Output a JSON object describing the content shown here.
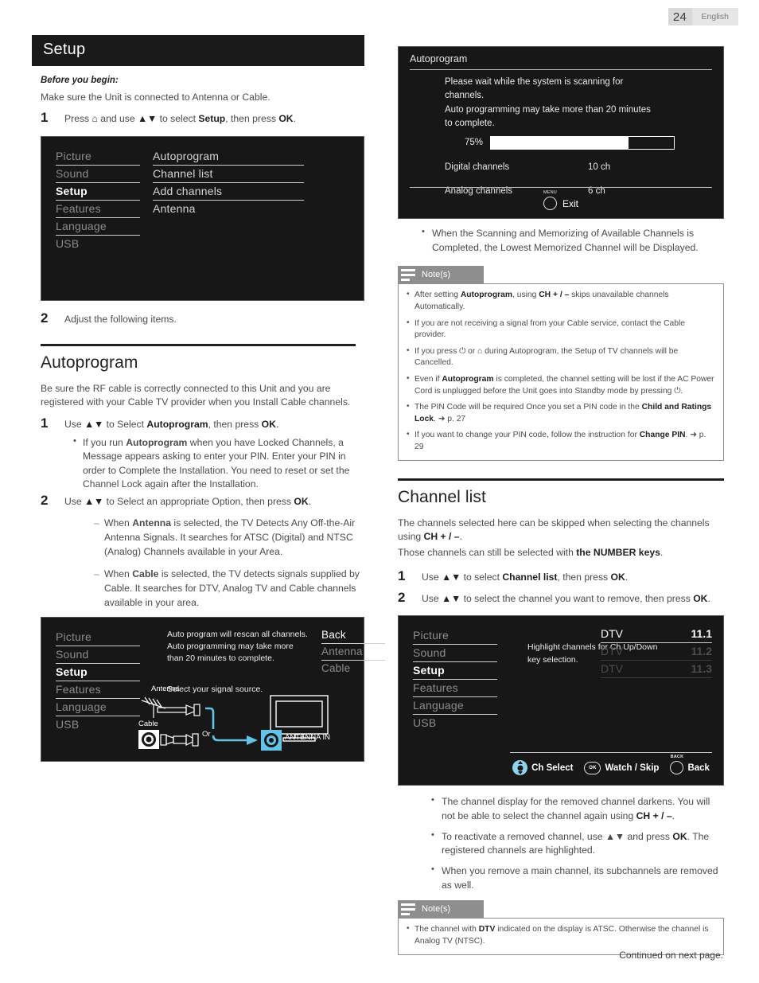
{
  "header": {
    "page_number": "24",
    "language": "English"
  },
  "footer": {
    "continued": "Continued on next page."
  },
  "left": {
    "section_title": "Setup",
    "before_you_begin": "Before you begin:",
    "intro": "Make sure the Unit is connected to Antenna or Cable.",
    "step1_num": "1",
    "step1_text_a": "Press ",
    "step1_home_icon": "⌂",
    "step1_text_b": " and use ",
    "step1_arrows": "▲▼",
    "step1_text_c": " to select ",
    "step1_bold": "Setup",
    "step1_text_d": ", then press ",
    "step1_ok": "OK",
    "step1_text_e": ".",
    "step2_num": "2",
    "step2_text": "Adjust the following items.",
    "tv_setup": {
      "left_menu": [
        "Picture",
        "Sound",
        "Setup",
        "Features",
        "Language",
        "USB"
      ],
      "selected": "Setup",
      "mid_menu": [
        "Autoprogram",
        "Channel list",
        "Add channels",
        "Antenna"
      ]
    },
    "autoprogram": {
      "heading": "Autoprogram",
      "intro": "Be sure the RF cable is correctly connected to this Unit and you are registered with your Cable TV provider when you Install Cable channels.",
      "step1_num": "1",
      "step1_a": "Use ",
      "step1_arrows": "▲▼",
      "step1_b": " to Select ",
      "step1_bold": "Autoprogram",
      "step1_c": ", then press ",
      "step1_ok": "OK",
      "step1_d": ".",
      "bullet1_a": "If you run ",
      "bullet1_bold": "Autoprogram",
      "bullet1_b": " when you have Locked Channels, a Message appears asking to enter your PIN. Enter your PIN in order to Complete the Installation. You need to reset or set the Channel Lock again after the Installation.",
      "step2_num": "2",
      "step2_a": "Use ",
      "step2_arrows": "▲▼",
      "step2_b": " to Select an appropriate Option, then press ",
      "step2_ok": "OK",
      "step2_c": ".",
      "dash1_a": "When ",
      "dash1_bold": "Antenna",
      "dash1_b": " is selected, the TV Detects Any Off-the-Air Antenna Signals. It searches for ATSC (Digital) and NTSC (Analog) Channels available in your Area.",
      "dash2_a": "When ",
      "dash2_bold": "Cable",
      "dash2_b": " is selected, the TV detects signals supplied by Cable. It searches for DTV, Analog TV and Cable channels available in your area."
    },
    "tv_auto": {
      "left_menu": [
        "Picture",
        "Sound",
        "Setup",
        "Features",
        "Language",
        "USB"
      ],
      "selected": "Setup",
      "message_line1": "Auto program will rescan all channels.",
      "message_line2": "Auto programming may take more",
      "message_line3": "than 20 minutes to complete.",
      "signal_prompt": "Select your signal source.",
      "options": [
        "Back",
        "Antenna",
        "Cable"
      ],
      "selected_option": "Back",
      "diagram": {
        "antenna_label": "Antenna",
        "cable_label": "Cable",
        "or_label": "Or",
        "antenna_in_label": "ANTENNA IN"
      }
    }
  },
  "right": {
    "tv_scan": {
      "title": "Autoprogram",
      "body_line1": "Please wait while the system is scanning for",
      "body_line2": "channels.",
      "body_line3": "Auto programming may take more than 20 minutes",
      "body_line4": "to complete.",
      "progress_percent": "75%",
      "progress_value": 75,
      "stats": [
        {
          "label": "Digital channels",
          "value": "10 ch"
        },
        {
          "label": "Analog channels",
          "value": "6 ch"
        }
      ],
      "exit_cap": "MENU",
      "exit_label": "Exit"
    },
    "scan_bullet": "When the Scanning and Memorizing of Available Channels is Completed, the Lowest Memorized Channel will be Displayed.",
    "notes1": {
      "title": "Note(s)",
      "items": [
        {
          "a": "After setting ",
          "b": "Autoprogram",
          "c": ", using ",
          "d": "CH + / –",
          "e": " skips unavailable channels Automatically."
        },
        {
          "a": "If you are not receiving a signal from your Cable service, contact the Cable provider."
        },
        {
          "a": "If you press ⏻ or ⌂ during Autoprogram, the Setup of TV channels will be Cancelled."
        },
        {
          "a": "Even if ",
          "b": "Autoprogram",
          "c": " is completed, the channel setting will be lost if the AC Power Cord is unplugged before the Unit goes into Standby mode by pressing ⏻."
        },
        {
          "a": "The PIN Code will be required Once you set a PIN code in the ",
          "b": "Child and Ratings Lock",
          "c": ". ➜ p. 27"
        },
        {
          "a": "If you want to change your PIN code, follow the instruction for ",
          "b": "Change PIN",
          "c": ". ➜ p. 29"
        }
      ]
    },
    "channel_list": {
      "heading": "Channel list",
      "intro_a": "The channels selected here can be skipped when selecting the channels using ",
      "intro_bold": "CH + / –",
      "intro_b": ".",
      "intro2_a": "Those channels can still be selected with ",
      "intro2_bold": "the NUMBER keys",
      "intro2_b": ".",
      "step1_num": "1",
      "step1_a": "Use ",
      "step1_arrows": "▲▼",
      "step1_b": " to select ",
      "step1_bold": "Channel list",
      "step1_c": ", then press ",
      "step1_ok": "OK",
      "step1_d": ".",
      "step2_num": "2",
      "step2_a": "Use ",
      "step2_arrows": "▲▼",
      "step2_b": " to select the channel you want to remove, then press ",
      "step2_ok": "OK",
      "step2_c": "."
    },
    "tv_chlist": {
      "left_menu": [
        "Picture",
        "Sound",
        "Setup",
        "Features",
        "Language",
        "USB"
      ],
      "selected": "Setup",
      "hint_line1": "Highlight channels for Ch Up/Down",
      "hint_line2": "key selection.",
      "channels": [
        {
          "type": "DTV",
          "number": "11.1",
          "active": true
        },
        {
          "type": "DTV",
          "number": "11.2",
          "active": false
        },
        {
          "type": "DTV",
          "number": "11.3",
          "active": false
        }
      ],
      "footer": [
        {
          "icon": "dpad-icon",
          "label": "Ch Select"
        },
        {
          "icon": "ok-icon",
          "label": "Watch / Skip"
        },
        {
          "icon": "back-icon",
          "cap": "BACK",
          "label": "Back"
        }
      ]
    },
    "chlist_bullets": [
      {
        "a": "The channel display for the removed channel darkens. You will not be able to select the channel again using ",
        "b": "CH + / –",
        "c": "."
      },
      {
        "a": "To reactivate a removed channel, use ▲▼ and press ",
        "b": "OK",
        "c": ". The registered channels are highlighted."
      },
      {
        "a": "When you remove a main channel, its subchannels are removed as well."
      }
    ],
    "notes2": {
      "title": "Note(s)",
      "items": [
        {
          "a": "The channel with ",
          "b": "DTV",
          "c": " indicated on the display is ATSC. Otherwise the channel is Analog TV (NTSC)."
        }
      ]
    }
  },
  "colors": {
    "section_bar": "#1a1a1a",
    "osd_bg": "#171717",
    "accent_blue": "#8fd3ef",
    "note_gray": "#8e8e8e"
  }
}
